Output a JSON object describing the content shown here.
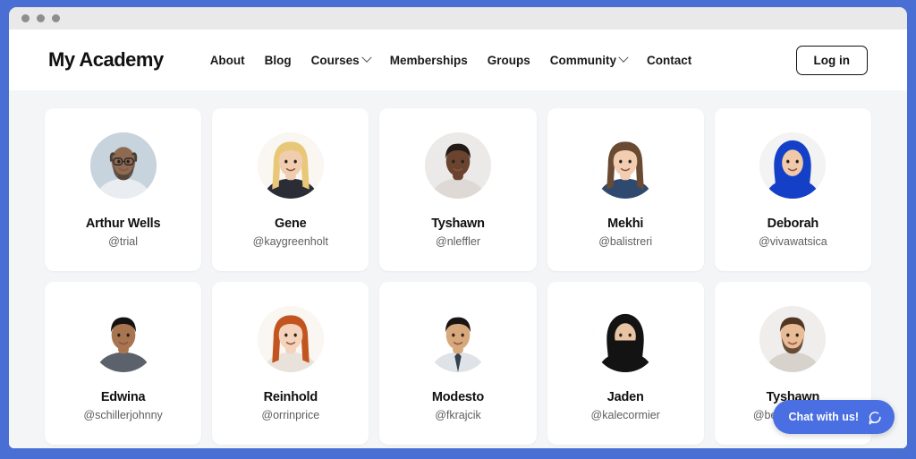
{
  "window": {
    "traffic_lights": [
      "close",
      "minimize",
      "maximize"
    ],
    "frame_color": "#4a6fd4",
    "titlebar_color": "#e9e9e9"
  },
  "header": {
    "brand": "My Academy",
    "nav": [
      {
        "label": "About",
        "has_dropdown": false
      },
      {
        "label": "Blog",
        "has_dropdown": false
      },
      {
        "label": "Courses",
        "has_dropdown": true
      },
      {
        "label": "Memberships",
        "has_dropdown": false
      },
      {
        "label": "Groups",
        "has_dropdown": false
      },
      {
        "label": "Community",
        "has_dropdown": true
      },
      {
        "label": "Contact",
        "has_dropdown": false
      }
    ],
    "login_label": "Log in"
  },
  "members": [
    {
      "name": "Arthur Wells",
      "handle": "@trial",
      "avatar": "man-glasses-bald-beard"
    },
    {
      "name": "Gene",
      "handle": "@kaygreenholt",
      "avatar": "woman-blonde-long-hair"
    },
    {
      "name": "Tyshawn",
      "handle": "@nleffler",
      "avatar": "man-smiling-dark-skin"
    },
    {
      "name": "Mekhi",
      "handle": "@balistreri",
      "avatar": "woman-brown-hair-updo"
    },
    {
      "name": "Deborah",
      "handle": "@vivawatsica",
      "avatar": "woman-blue-hijab"
    },
    {
      "name": "Edwina",
      "handle": "@schillerjohnny",
      "avatar": "man-black-hair-suit"
    },
    {
      "name": "Reinhold",
      "handle": "@orrinprice",
      "avatar": "woman-red-curly-hair"
    },
    {
      "name": "Modesto",
      "handle": "@fkrajcik",
      "avatar": "man-asian-shirt-tie"
    },
    {
      "name": "Jaden",
      "handle": "@kalecormier",
      "avatar": "woman-black-niqab"
    },
    {
      "name": "Tyshawn",
      "handle": "@bethelwunsch",
      "avatar": "man-beard-brown-hair"
    }
  ],
  "chat": {
    "label": "Chat with us!",
    "icon": "speech-bubble-icon",
    "color": "#4a6fe3"
  },
  "colors": {
    "page_background": "#f4f5f7",
    "card_background": "#ffffff",
    "text_primary": "#111111",
    "text_secondary": "#5e5e5e",
    "accent": "#4a6fe3"
  }
}
